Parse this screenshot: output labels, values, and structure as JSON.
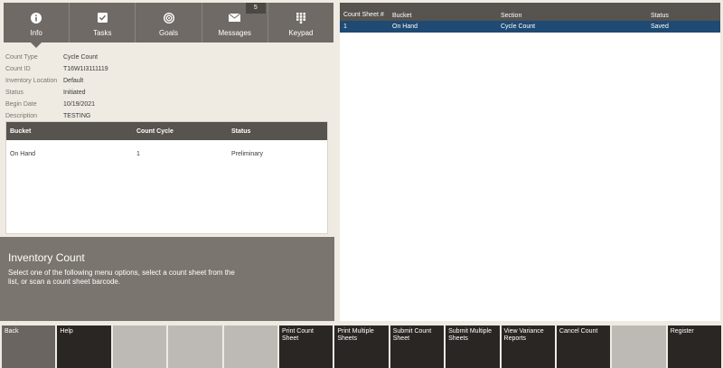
{
  "nav": {
    "tabs": [
      {
        "label": "Info",
        "icon": "info-icon"
      },
      {
        "label": "Tasks",
        "icon": "check-square-icon"
      },
      {
        "label": "Goals",
        "icon": "target-icon"
      },
      {
        "label": "Messages",
        "icon": "envelope-icon"
      },
      {
        "label": "Keypad",
        "icon": "keypad-icon"
      }
    ],
    "messages_badge": "5"
  },
  "info": [
    {
      "k": "Count Type",
      "v": "Cycle Count"
    },
    {
      "k": "Count ID",
      "v": "T16W1I3111119"
    },
    {
      "k": "Inventory Location",
      "v": "Default"
    },
    {
      "k": "Status",
      "v": "Initiated"
    },
    {
      "k": "Begin Date",
      "v": "10/19/2021"
    },
    {
      "k": "Description",
      "v": "TESTING"
    }
  ],
  "bucket_table": {
    "headers": [
      "Bucket",
      "Count Cycle",
      "Status"
    ],
    "rows": [
      [
        "On Hand",
        "1",
        "Preliminary"
      ]
    ]
  },
  "prompt": {
    "title": "Inventory Count",
    "text": "Select one of the following menu options, select a count sheet from the list, or scan a count sheet barcode."
  },
  "sheet_table": {
    "headers": [
      "Count Sheet #",
      "Bucket",
      "Section",
      "Status"
    ],
    "rows": [
      [
        "1",
        "On Hand",
        "Cycle Count",
        "Saved"
      ]
    ]
  },
  "actions": [
    {
      "label": "Back",
      "state": "back"
    },
    {
      "label": "Help",
      "state": "enabled"
    },
    {
      "label": "",
      "state": "disabled"
    },
    {
      "label": "",
      "state": "disabled"
    },
    {
      "label": "",
      "state": "disabled"
    },
    {
      "label": "Print Count Sheet",
      "state": "enabled"
    },
    {
      "label": "Print Multiple Sheets",
      "state": "enabled"
    },
    {
      "label": "Submit Count Sheet",
      "state": "enabled"
    },
    {
      "label": "Submit Multiple Sheets",
      "state": "enabled"
    },
    {
      "label": "View Variance Reports",
      "state": "enabled"
    },
    {
      "label": "Cancel Count",
      "state": "enabled"
    },
    {
      "label": "",
      "state": "disabled"
    },
    {
      "label": "Register",
      "state": "enabled"
    }
  ],
  "colors": {
    "nav_bg": "#6f6a66",
    "selected_row": "#1e4a73",
    "action_bg": "#2a2623",
    "disabled_bg": "#bdbab6"
  }
}
